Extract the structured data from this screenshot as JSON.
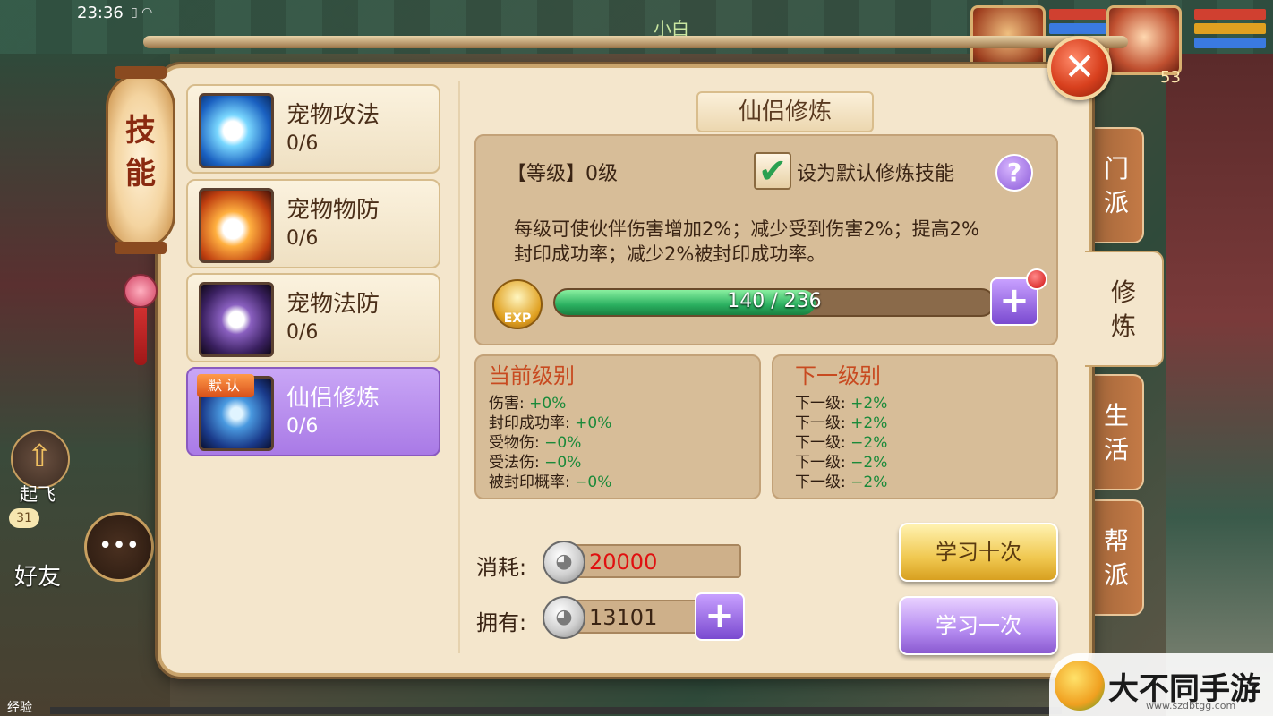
{
  "status_bar": {
    "time": "23:36",
    "icons": "▯ ◠"
  },
  "hud": {
    "player_name": "小白",
    "pet_level": "53",
    "exp_label": "经验",
    "fly_label": "起飞",
    "friends_label": "好友",
    "friends_badge": "31"
  },
  "lantern": {
    "title_1": "技",
    "title_2": "能"
  },
  "close_button": "✕",
  "skills": [
    {
      "name": "宠物攻法",
      "progress": "0/6",
      "icon": "pet-attack-icon"
    },
    {
      "name": "宠物物防",
      "progress": "0/6",
      "icon": "pet-physical-defense-icon"
    },
    {
      "name": "宠物法防",
      "progress": "0/6",
      "icon": "pet-magic-defense-icon"
    },
    {
      "name": "仙侣修炼",
      "progress": "0/6",
      "icon": "companion-training-icon",
      "tag": "默认",
      "selected": true
    }
  ],
  "detail": {
    "title": "仙侣修炼",
    "level": "【等级】0级",
    "default_checkbox_label": "设为默认修炼技能",
    "checkbox_checked": true,
    "help": "?",
    "description_line1": "每级可使伙伴伤害增加2%；减少受到伤害2%；提高2%",
    "description_line2": "封印成功率；减少2%被封印成功率。",
    "exp_badge": "EXP",
    "exp_text": "140 / 236",
    "exp_current": 140,
    "exp_max": 236,
    "plus": "+"
  },
  "current_level": {
    "title": "当前级别",
    "rows": [
      {
        "label": "伤害: ",
        "value": "+0%"
      },
      {
        "label": "封印成功率: ",
        "value": "+0%"
      },
      {
        "label": "受物伤: ",
        "value": "−0%"
      },
      {
        "label": "受法伤: ",
        "value": "−0%"
      },
      {
        "label": "被封印概率: ",
        "value": "−0%"
      }
    ]
  },
  "next_level": {
    "title": "下一级别",
    "rows": [
      {
        "label": "下一级: ",
        "value": "+2%"
      },
      {
        "label": "下一级: ",
        "value": "+2%"
      },
      {
        "label": "下一级: ",
        "value": "−2%"
      },
      {
        "label": "下一级: ",
        "value": "−2%"
      },
      {
        "label": "下一级: ",
        "value": "−2%"
      }
    ]
  },
  "cost": {
    "label": "消耗:",
    "value": "20000"
  },
  "owned": {
    "label": "拥有:",
    "value": "13101"
  },
  "buttons": {
    "learn_ten": "学习十次",
    "learn_one": "学习一次"
  },
  "side_tabs": [
    {
      "label_1": "门",
      "label_2": "派"
    },
    {
      "label_1": "修",
      "label_2": "炼",
      "active": true
    },
    {
      "label_1": "生",
      "label_2": "活"
    },
    {
      "label_1": "帮",
      "label_2": "派"
    }
  ],
  "watermark": {
    "text": "大不同手游网",
    "url": "www.szdbtgg.com"
  },
  "colors": {
    "accent_purple": "#a97ae6",
    "cost_red": "#e01010",
    "positive_green": "#1a8a3a",
    "exp_green": "#2ab060"
  }
}
